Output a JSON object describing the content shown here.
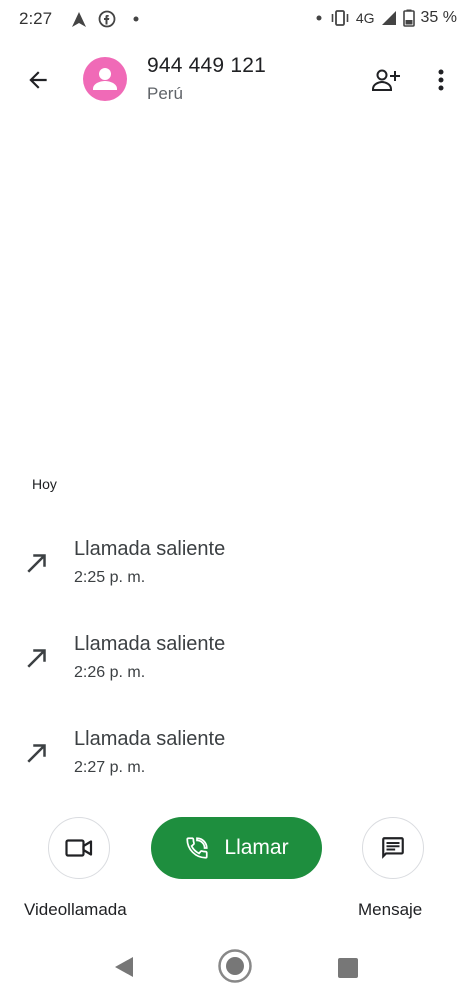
{
  "status_bar": {
    "time": "2:27",
    "network": "4G",
    "battery": "35 %"
  },
  "header": {
    "phone_number": "944 449 121",
    "country": "Perú",
    "avatar_color": "#f06ab7"
  },
  "history": {
    "section_label": "Hoy",
    "calls": [
      {
        "type": "Llamada saliente",
        "time": "2:25 p. m."
      },
      {
        "type": "Llamada saliente",
        "time": "2:26 p. m."
      },
      {
        "type": "Llamada saliente",
        "time": "2:27 p. m."
      }
    ]
  },
  "actions": {
    "video_label": "Videollamada",
    "call_label": "Llamar",
    "message_label": "Mensaje",
    "call_color": "#1e8e3e"
  }
}
